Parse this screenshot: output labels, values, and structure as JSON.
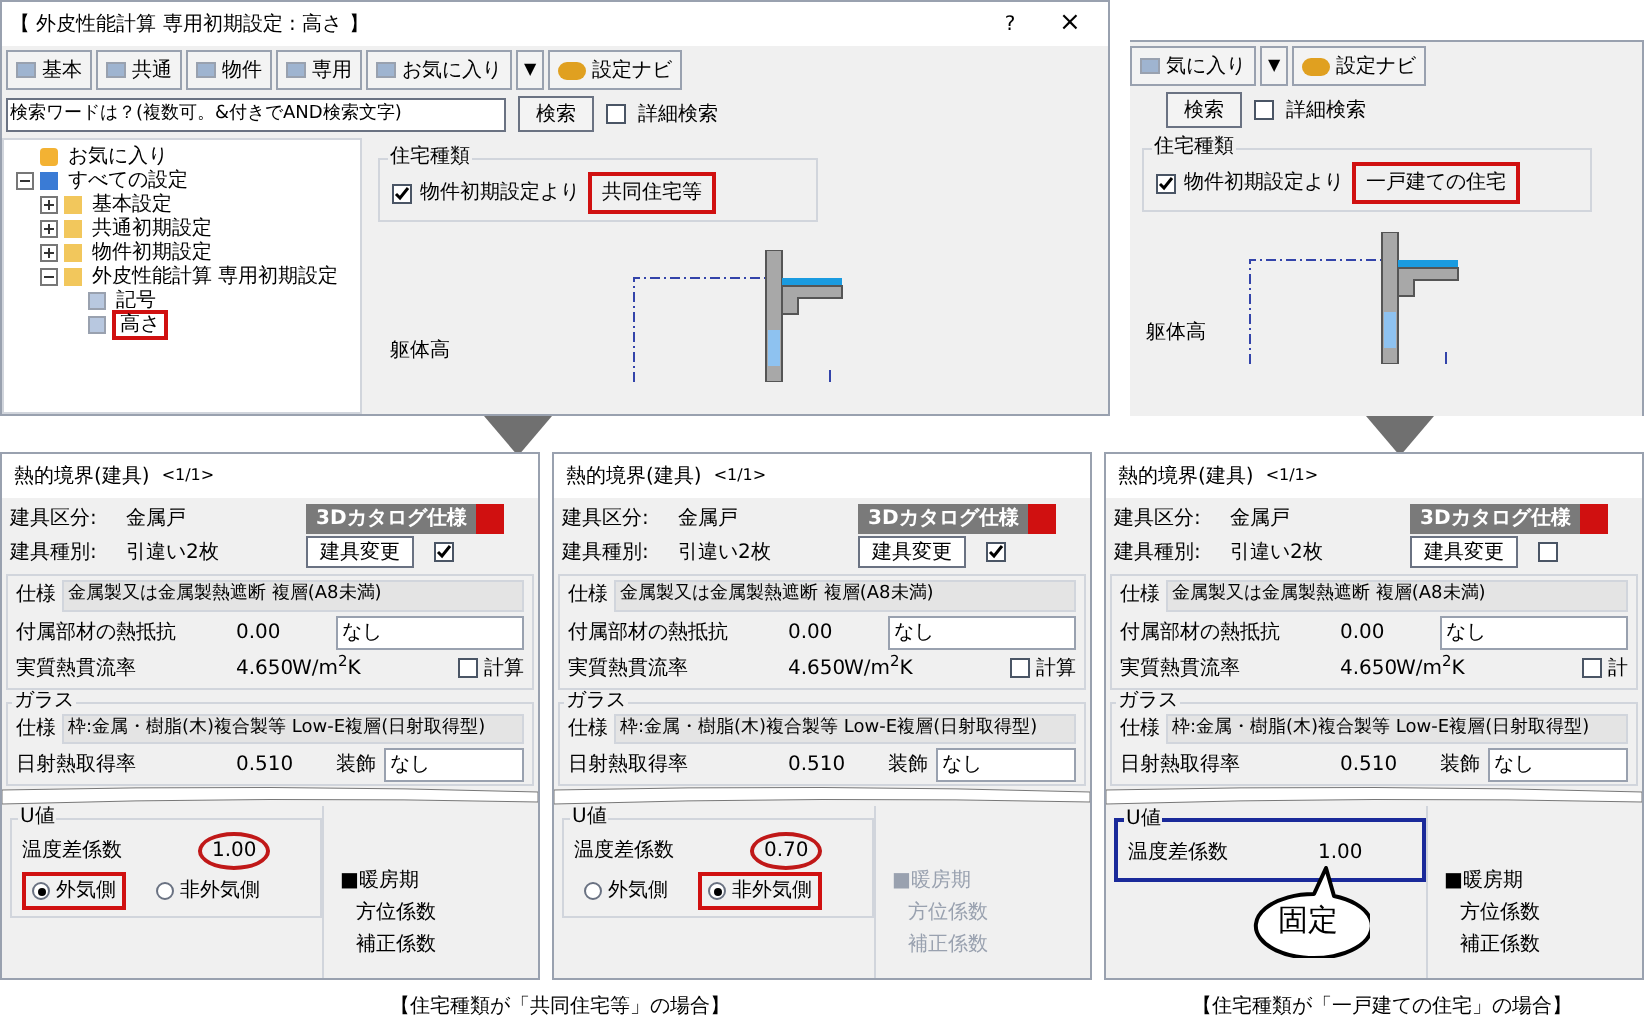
{
  "left_window": {
    "title": "【 外皮性能計算 専用初期設定 : 高さ 】",
    "help": "?",
    "close": "×",
    "toolbar": [
      {
        "label": "基本",
        "kind": "tab"
      },
      {
        "label": "共通",
        "kind": "tab"
      },
      {
        "label": "物件",
        "kind": "tab"
      },
      {
        "label": "専用",
        "kind": "tab"
      },
      {
        "label": "お気に入り",
        "kind": "tab"
      },
      {
        "label": "▼",
        "kind": "drop"
      },
      {
        "label": "設定ナビ",
        "kind": "navi"
      }
    ],
    "search": {
      "placeholder": "検索ワードは？(複数可。&付きでAND検索文字)",
      "button": "検索",
      "detail": "詳細検索",
      "detail_checked": false
    },
    "tree": [
      {
        "label": "お気に入り",
        "kind": "fav",
        "selected": false
      },
      {
        "label": "すべての設定",
        "kind": "root",
        "expanded": true,
        "selected": false,
        "children": [
          {
            "label": "基本設定",
            "kind": "folder",
            "expanded": false,
            "selected": false
          },
          {
            "label": "共通初期設定",
            "kind": "folder",
            "expanded": false,
            "selected": false
          },
          {
            "label": "物件初期設定",
            "kind": "folder",
            "expanded": false,
            "selected": false
          },
          {
            "label": "外皮性能計算 専用初期設定",
            "kind": "folder",
            "expanded": true,
            "selected": false,
            "children": [
              {
                "label": "記号",
                "kind": "page",
                "selected": false
              },
              {
                "label": "高さ",
                "kind": "page",
                "selected": true
              }
            ]
          }
        ]
      }
    ],
    "house_type": {
      "legend": "住宅種類",
      "checkbox": "物件初期設定より",
      "checked": true,
      "value": "共同住宅等",
      "highlighted": true
    },
    "drawing_label": "躯体高"
  },
  "right_window": {
    "toolbar": [
      {
        "label": "気に入り",
        "kind": "tab"
      },
      {
        "label": "▼",
        "kind": "drop"
      },
      {
        "label": "設定ナビ",
        "kind": "navi"
      }
    ],
    "search": {
      "button": "検索",
      "detail": "詳細検索",
      "detail_checked": false
    },
    "house_type": {
      "legend": "住宅種類",
      "checkbox": "物件初期設定より",
      "checked": true,
      "value": "一戸建ての住宅",
      "highlighted": true
    },
    "drawing_label": "躯体高"
  },
  "panels": [
    {
      "title": "熱的境界(建具)",
      "page": "<1/1>",
      "kind_label": "建具区分:",
      "kind_value": "金属戸",
      "type_label": "建具種別:",
      "type_value": "引違い2枚",
      "catalog": "3Dカタログ仕様",
      "change": "建具変更",
      "checked": true,
      "spec_label": "仕様",
      "spec": "金属製又は金属製熱遮断 複層(A8未満)",
      "resist_label": "付属部材の熱抵抗",
      "resist": "0.00",
      "resist_select": "なし",
      "u_label": "実質熱貫流率",
      "u": "4.650",
      "u_unit": "W/m$^{2}$K",
      "calc": "計算",
      "calc_checked": false,
      "glass_legend": "ガラス",
      "glass_spec_label": "仕様",
      "glass_spec": "枠:金属・樹脂(木)複合製等 Low-E複層(日射取得型)",
      "solar_label": "日射熱取得率",
      "solar": "0.510",
      "deco_label": "装飾",
      "deco": "なし",
      "uval": {
        "legend": "U値",
        "coef_label": "温度差係数",
        "coef": "1.00",
        "circled": true,
        "boxed": false,
        "options": [
          {
            "label": "外気側",
            "selected": true
          },
          {
            "label": "非外気側",
            "selected": false
          }
        ]
      },
      "heating": {
        "label": "■暖房期",
        "items": [
          "方位係数",
          "補正係数"
        ],
        "disabled": false
      }
    },
    {
      "title": "熱的境界(建具)",
      "page": "<1/1>",
      "kind_label": "建具区分:",
      "kind_value": "金属戸",
      "type_label": "建具種別:",
      "type_value": "引違い2枚",
      "catalog": "3Dカタログ仕様",
      "change": "建具変更",
      "checked": true,
      "spec_label": "仕様",
      "spec": "金属製又は金属製熱遮断 複層(A8未満)",
      "resist_label": "付属部材の熱抵抗",
      "resist": "0.00",
      "resist_select": "なし",
      "u_label": "実質熱貫流率",
      "u": "4.650",
      "u_unit": "W/m$^{2}$K",
      "calc": "計算",
      "calc_checked": false,
      "glass_legend": "ガラス",
      "glass_spec_label": "仕様",
      "glass_spec": "枠:金属・樹脂(木)複合製等 Low-E複層(日射取得型)",
      "solar_label": "日射熱取得率",
      "solar": "0.510",
      "deco_label": "装飾",
      "deco": "なし",
      "uval": {
        "legend": "U値",
        "coef_label": "温度差係数",
        "coef": "0.70",
        "circled": true,
        "boxed": false,
        "options": [
          {
            "label": "外気側",
            "selected": false
          },
          {
            "label": "非外気側",
            "selected": true
          }
        ]
      },
      "heating": {
        "label": "■暖房期",
        "items": [
          "方位係数",
          "補正係数"
        ],
        "disabled": true
      }
    },
    {
      "title": "熱的境界(建具)",
      "page": "<1/1>",
      "kind_label": "建具区分:",
      "kind_value": "金属戸",
      "type_label": "建具種別:",
      "type_value": "引違い2枚",
      "catalog": "3Dカタログ仕様",
      "change": "建具変更",
      "checked": false,
      "spec_label": "仕様",
      "spec": "金属製又は金属製熱遮断 複層(A8未満)",
      "resist_label": "付属部材の熱抵抗",
      "resist": "0.00",
      "resist_select": "なし",
      "u_label": "実質熱貫流率",
      "u": "4.650",
      "u_unit": "W/m$^{2}$K",
      "calc": "計",
      "calc_checked": false,
      "glass_legend": "ガラス",
      "glass_spec_label": "仕様",
      "glass_spec": "枠:金属・樹脂(木)複合製等 Low-E複層(日射取得型)",
      "solar_label": "日射熱取得率",
      "solar": "0.510",
      "deco_label": "装飾",
      "deco": "なし",
      "uval": {
        "legend": "U値",
        "coef_label": "温度差係数",
        "coef": "1.00",
        "circled": false,
        "boxed": true,
        "callout": "固定"
      },
      "heating": {
        "label": "■暖房期",
        "items": [
          "方位係数",
          "補正係数"
        ],
        "disabled": false
      }
    }
  ],
  "captions": [
    "【住宅種類が「共同住宅等」の場合】",
    "【住宅種類が「一戸建ての住宅」の場合】"
  ]
}
